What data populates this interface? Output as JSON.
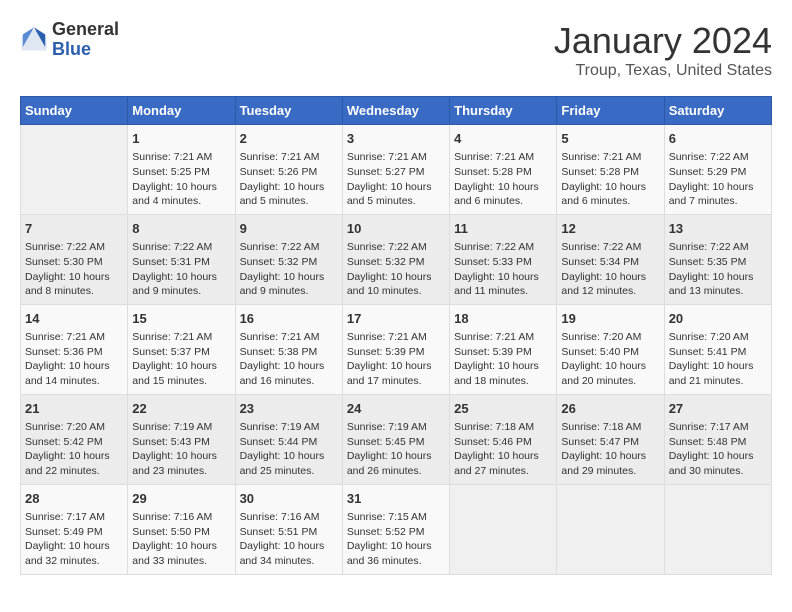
{
  "header": {
    "logo_general": "General",
    "logo_blue": "Blue",
    "calendar_title": "January 2024",
    "calendar_subtitle": "Troup, Texas, United States"
  },
  "days_of_week": [
    "Sunday",
    "Monday",
    "Tuesday",
    "Wednesday",
    "Thursday",
    "Friday",
    "Saturday"
  ],
  "weeks": [
    [
      {
        "day": "",
        "info": ""
      },
      {
        "day": "1",
        "info": "Sunrise: 7:21 AM\nSunset: 5:25 PM\nDaylight: 10 hours\nand 4 minutes."
      },
      {
        "day": "2",
        "info": "Sunrise: 7:21 AM\nSunset: 5:26 PM\nDaylight: 10 hours\nand 5 minutes."
      },
      {
        "day": "3",
        "info": "Sunrise: 7:21 AM\nSunset: 5:27 PM\nDaylight: 10 hours\nand 5 minutes."
      },
      {
        "day": "4",
        "info": "Sunrise: 7:21 AM\nSunset: 5:28 PM\nDaylight: 10 hours\nand 6 minutes."
      },
      {
        "day": "5",
        "info": "Sunrise: 7:21 AM\nSunset: 5:28 PM\nDaylight: 10 hours\nand 6 minutes."
      },
      {
        "day": "6",
        "info": "Sunrise: 7:22 AM\nSunset: 5:29 PM\nDaylight: 10 hours\nand 7 minutes."
      }
    ],
    [
      {
        "day": "7",
        "info": "Sunrise: 7:22 AM\nSunset: 5:30 PM\nDaylight: 10 hours\nand 8 minutes."
      },
      {
        "day": "8",
        "info": "Sunrise: 7:22 AM\nSunset: 5:31 PM\nDaylight: 10 hours\nand 9 minutes."
      },
      {
        "day": "9",
        "info": "Sunrise: 7:22 AM\nSunset: 5:32 PM\nDaylight: 10 hours\nand 9 minutes."
      },
      {
        "day": "10",
        "info": "Sunrise: 7:22 AM\nSunset: 5:32 PM\nDaylight: 10 hours\nand 10 minutes."
      },
      {
        "day": "11",
        "info": "Sunrise: 7:22 AM\nSunset: 5:33 PM\nDaylight: 10 hours\nand 11 minutes."
      },
      {
        "day": "12",
        "info": "Sunrise: 7:22 AM\nSunset: 5:34 PM\nDaylight: 10 hours\nand 12 minutes."
      },
      {
        "day": "13",
        "info": "Sunrise: 7:22 AM\nSunset: 5:35 PM\nDaylight: 10 hours\nand 13 minutes."
      }
    ],
    [
      {
        "day": "14",
        "info": "Sunrise: 7:21 AM\nSunset: 5:36 PM\nDaylight: 10 hours\nand 14 minutes."
      },
      {
        "day": "15",
        "info": "Sunrise: 7:21 AM\nSunset: 5:37 PM\nDaylight: 10 hours\nand 15 minutes."
      },
      {
        "day": "16",
        "info": "Sunrise: 7:21 AM\nSunset: 5:38 PM\nDaylight: 10 hours\nand 16 minutes."
      },
      {
        "day": "17",
        "info": "Sunrise: 7:21 AM\nSunset: 5:39 PM\nDaylight: 10 hours\nand 17 minutes."
      },
      {
        "day": "18",
        "info": "Sunrise: 7:21 AM\nSunset: 5:39 PM\nDaylight: 10 hours\nand 18 minutes."
      },
      {
        "day": "19",
        "info": "Sunrise: 7:20 AM\nSunset: 5:40 PM\nDaylight: 10 hours\nand 20 minutes."
      },
      {
        "day": "20",
        "info": "Sunrise: 7:20 AM\nSunset: 5:41 PM\nDaylight: 10 hours\nand 21 minutes."
      }
    ],
    [
      {
        "day": "21",
        "info": "Sunrise: 7:20 AM\nSunset: 5:42 PM\nDaylight: 10 hours\nand 22 minutes."
      },
      {
        "day": "22",
        "info": "Sunrise: 7:19 AM\nSunset: 5:43 PM\nDaylight: 10 hours\nand 23 minutes."
      },
      {
        "day": "23",
        "info": "Sunrise: 7:19 AM\nSunset: 5:44 PM\nDaylight: 10 hours\nand 25 minutes."
      },
      {
        "day": "24",
        "info": "Sunrise: 7:19 AM\nSunset: 5:45 PM\nDaylight: 10 hours\nand 26 minutes."
      },
      {
        "day": "25",
        "info": "Sunrise: 7:18 AM\nSunset: 5:46 PM\nDaylight: 10 hours\nand 27 minutes."
      },
      {
        "day": "26",
        "info": "Sunrise: 7:18 AM\nSunset: 5:47 PM\nDaylight: 10 hours\nand 29 minutes."
      },
      {
        "day": "27",
        "info": "Sunrise: 7:17 AM\nSunset: 5:48 PM\nDaylight: 10 hours\nand 30 minutes."
      }
    ],
    [
      {
        "day": "28",
        "info": "Sunrise: 7:17 AM\nSunset: 5:49 PM\nDaylight: 10 hours\nand 32 minutes."
      },
      {
        "day": "29",
        "info": "Sunrise: 7:16 AM\nSunset: 5:50 PM\nDaylight: 10 hours\nand 33 minutes."
      },
      {
        "day": "30",
        "info": "Sunrise: 7:16 AM\nSunset: 5:51 PM\nDaylight: 10 hours\nand 34 minutes."
      },
      {
        "day": "31",
        "info": "Sunrise: 7:15 AM\nSunset: 5:52 PM\nDaylight: 10 hours\nand 36 minutes."
      },
      {
        "day": "",
        "info": ""
      },
      {
        "day": "",
        "info": ""
      },
      {
        "day": "",
        "info": ""
      }
    ]
  ]
}
